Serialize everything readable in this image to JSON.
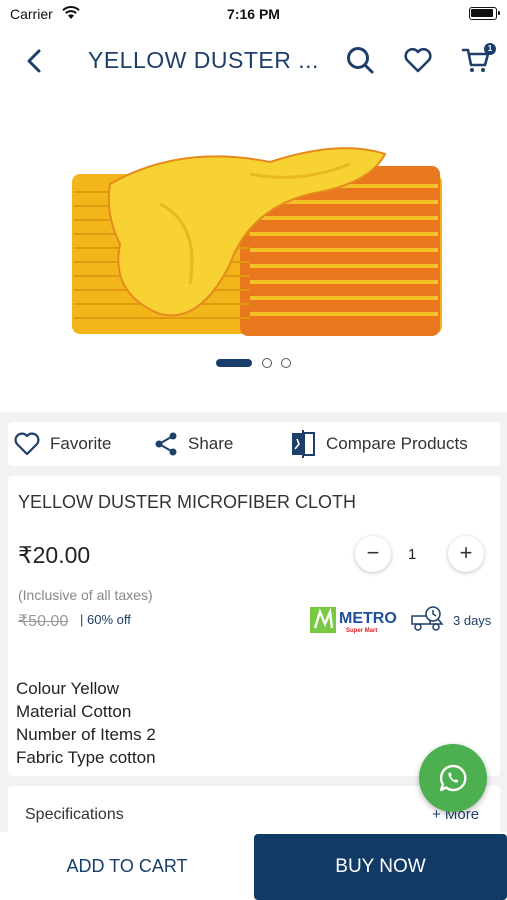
{
  "status_bar": {
    "carrier": "Carrier",
    "time": "7:16 PM"
  },
  "nav": {
    "title": "YELLOW DUSTER ...",
    "cart_count": "1",
    "icons": [
      "back-chevron-icon",
      "search-icon",
      "heart-icon",
      "cart-icon"
    ]
  },
  "gallery": {
    "image_count": 3,
    "active_index": 0
  },
  "actions": {
    "favorite": "Favorite",
    "share": "Share",
    "compare": "Compare Products"
  },
  "product": {
    "name": "YELLOW DUSTER MICROFIBER CLOTH",
    "price": "₹20.00",
    "quantity": "1",
    "tax_note": "(Inclusive of all taxes)",
    "mrp": "₹50.00",
    "discount": "| 60% off",
    "seller_logo_text": "METRO",
    "seller_logo_sub": "Super Mart",
    "delivery": "3 days",
    "attributes": [
      "Colour Yellow",
      "Material Cotton",
      "Number of Items 2",
      "Fabric Type cotton"
    ]
  },
  "specifications": {
    "label": "Specifications",
    "more": "+ More"
  },
  "bottom": {
    "add_to_cart": "ADD TO CART",
    "buy_now": "BUY NOW"
  },
  "colors": {
    "brand_navy": "#123a66",
    "accent_green": "#4caf50",
    "duster_yellow": "#f6c71a",
    "duster_orange": "#e9771e"
  }
}
